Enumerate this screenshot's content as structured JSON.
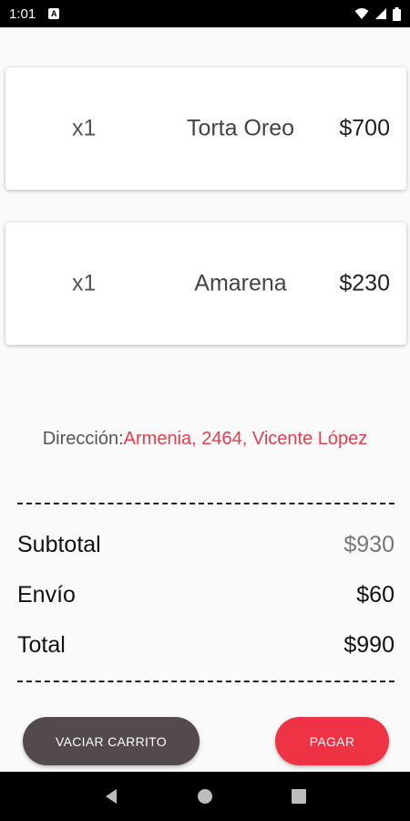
{
  "status_bar": {
    "time": "1:01",
    "notification_letter": "A",
    "icons": [
      "wifi-icon",
      "signal-icon",
      "battery-icon"
    ]
  },
  "cart": {
    "items": [
      {
        "quantity": "x1",
        "name": "Torta Oreo",
        "price": "$700"
      },
      {
        "quantity": "x1",
        "name": "Amarena",
        "price": "$230"
      }
    ]
  },
  "address": {
    "label": "Dirección:",
    "value": "Armenia, 2464, Vicente López"
  },
  "totals": {
    "subtotal_label": "Subtotal",
    "subtotal_value": "$930",
    "shipping_label": "Envío",
    "shipping_value": "$60",
    "total_label": "Total",
    "total_value": "$990"
  },
  "actions": {
    "empty_cart_label": "VACIAR CARRITO",
    "pay_label": "PAGAR"
  },
  "colors": {
    "accent": "#ee3344",
    "secondary_button": "#54494b",
    "address_highlight": "#ee3b4b"
  },
  "nav_bar": {
    "icons": [
      "back-icon",
      "home-icon",
      "recents-icon"
    ]
  }
}
